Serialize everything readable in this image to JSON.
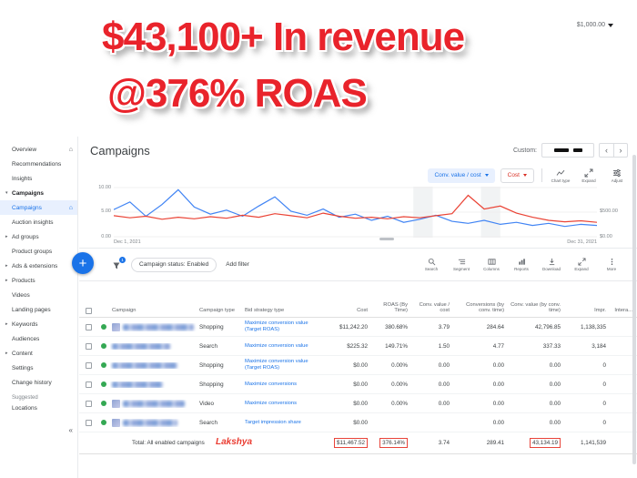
{
  "colors": {
    "accent_blue": "#1a73e8",
    "line_blue": "#4285f4",
    "line_red": "#ea4335",
    "banner_red": "#e9232b",
    "highlight_red": "#e8443a",
    "status_green": "#34a853"
  },
  "banner": {
    "line1": "$43,100+ In revenue",
    "line2": "@376% ROAS",
    "peek_value": "$1,000.00"
  },
  "sidebar": {
    "items": [
      {
        "label": "Overview",
        "icon": "home"
      },
      {
        "label": "Recommendations"
      },
      {
        "label": "Insights"
      },
      {
        "label": "Campaigns",
        "arrow": "down",
        "section": true
      },
      {
        "label": "Campaigns",
        "selected": true,
        "icon": "home"
      },
      {
        "label": "Auction insights"
      },
      {
        "label": "Ad groups",
        "arrow": "right"
      },
      {
        "label": "Product groups"
      },
      {
        "label": "Ads & extensions",
        "arrow": "right"
      },
      {
        "label": "Products",
        "arrow": "right"
      },
      {
        "label": "Videos"
      },
      {
        "label": "Landing pages"
      },
      {
        "label": "Keywords",
        "arrow": "right"
      },
      {
        "label": "Audiences"
      },
      {
        "label": "Content",
        "arrow": "right"
      },
      {
        "label": "Settings"
      },
      {
        "label": "Change history"
      }
    ],
    "suggested_label": "Suggested",
    "suggested_items": [
      {
        "label": "Locations"
      }
    ],
    "collapse_icon": "«"
  },
  "header": {
    "title": "Campaigns",
    "date_range_label": "Custom:"
  },
  "chart_controls": {
    "metric1": {
      "label": "Conv. value / cost"
    },
    "metric2": {
      "label": "Cost"
    },
    "tools": [
      {
        "label": "Chart type",
        "icon": "chart-type"
      },
      {
        "label": "Expand",
        "icon": "expand"
      },
      {
        "label": "Adjust",
        "icon": "adjust"
      }
    ]
  },
  "chart_data": {
    "type": "line",
    "x_start_label": "Dec 1, 2021",
    "x_end_label": "Dec 31, 2021",
    "left_axis_ticks": [
      "10.00",
      "5.00",
      "0.00"
    ],
    "right_axis_ticks": [
      "$500.00",
      "$0.00"
    ],
    "left_range": [
      0,
      10
    ],
    "right_range": [
      0,
      1000
    ],
    "highlight_bands": [
      {
        "from": 0.62,
        "to": 0.66
      },
      {
        "from": 0.76,
        "to": 0.8
      }
    ],
    "series": [
      {
        "name": "Conv. value / cost",
        "axis": "left",
        "color": "#4285f4",
        "values": [
          5.5,
          7.0,
          4.2,
          6.5,
          9.4,
          6.0,
          4.6,
          5.4,
          4.2,
          6.2,
          8.0,
          5.2,
          4.4,
          5.6,
          4.0,
          4.6,
          3.4,
          4.2,
          3.0,
          3.6,
          4.4,
          3.2,
          2.8,
          3.4,
          2.6,
          3.0,
          2.4,
          2.8,
          2.2,
          2.6,
          2.4
        ]
      },
      {
        "name": "Cost",
        "axis": "right",
        "color": "#ea4335",
        "values": [
          430,
          390,
          420,
          360,
          400,
          370,
          410,
          380,
          440,
          400,
          470,
          430,
          390,
          480,
          420,
          380,
          400,
          370,
          410,
          390,
          430,
          470,
          830,
          560,
          620,
          480,
          400,
          340,
          310,
          330,
          300
        ]
      }
    ]
  },
  "filter_bar": {
    "filter_count": "1",
    "status_chip": "Campaign status: Enabled",
    "add_filter_label": "Add filter",
    "tools": [
      {
        "label": "Search",
        "icon": "search"
      },
      {
        "label": "Segment",
        "icon": "segment"
      },
      {
        "label": "Columns",
        "icon": "columns"
      },
      {
        "label": "Reports",
        "icon": "reports"
      },
      {
        "label": "Download",
        "icon": "download"
      },
      {
        "label": "Expand",
        "icon": "expand"
      },
      {
        "label": "More",
        "icon": "more"
      }
    ]
  },
  "table": {
    "columns": [
      {
        "key": "campaign",
        "label": "Campaign",
        "align": "left"
      },
      {
        "key": "type",
        "label": "Campaign type",
        "align": "left"
      },
      {
        "key": "bid",
        "label": "Bid strategy type",
        "align": "left"
      },
      {
        "key": "cost",
        "label": "Cost",
        "align": "right"
      },
      {
        "key": "roas",
        "label": "ROAS (By Time)",
        "align": "right"
      },
      {
        "key": "cvc",
        "label": "Conv. value / cost",
        "align": "right"
      },
      {
        "key": "conversions",
        "label": "Conversions (by conv. time)",
        "align": "right"
      },
      {
        "key": "convvalue",
        "label": "Conv. value (by conv. time)",
        "align": "right"
      },
      {
        "key": "impr",
        "label": "Impr.",
        "align": "right"
      },
      {
        "key": "interactions",
        "label": "Intera...",
        "align": "right"
      }
    ],
    "rows": [
      {
        "status": "enabled",
        "thumb": true,
        "redacted": true,
        "type": "Shopping",
        "bid": "Maximize conversion value (Target ROAS)",
        "cost": "$11,242.20",
        "roas": "380.68%",
        "cvc": "3.79",
        "conversions": "284.64",
        "convvalue": "42,796.85",
        "impr": "1,138,335",
        "interactions": ""
      },
      {
        "status": "enabled",
        "thumb": false,
        "redacted": true,
        "type": "Search",
        "bid": "Maximize conversion value",
        "cost": "$225.32",
        "roas": "149.71%",
        "cvc": "1.50",
        "conversions": "4.77",
        "convvalue": "337.33",
        "impr": "3,184",
        "interactions": ""
      },
      {
        "status": "enabled",
        "thumb": false,
        "redacted": true,
        "type": "Shopping",
        "bid": "Maximize conversion value (Target ROAS)",
        "cost": "$0.00",
        "roas": "0.00%",
        "cvc": "0.00",
        "conversions": "0.00",
        "convvalue": "0.00",
        "impr": "0",
        "interactions": ""
      },
      {
        "status": "enabled",
        "thumb": false,
        "redacted": true,
        "type": "Shopping",
        "bid": "Maximize conversions",
        "cost": "$0.00",
        "roas": "0.00%",
        "cvc": "0.00",
        "conversions": "0.00",
        "convvalue": "0.00",
        "impr": "0",
        "interactions": ""
      },
      {
        "status": "enabled",
        "thumb": true,
        "redacted": true,
        "type": "Video",
        "bid": "Maximize conversions",
        "cost": "$0.00",
        "roas": "0.00%",
        "cvc": "0.00",
        "conversions": "0.00",
        "convvalue": "0.00",
        "impr": "0",
        "interactions": ""
      },
      {
        "status": "enabled",
        "thumb": true,
        "redacted": true,
        "type": "Search",
        "bid": "Target impression share",
        "cost": "$0.00",
        "roas": "",
        "cvc": "",
        "conversions": "0.00",
        "convvalue": "0.00",
        "impr": "0",
        "interactions": ""
      }
    ],
    "total_row": {
      "label": "Total: All enabled campaigns",
      "cost": "$11,467.52",
      "roas": "376.14%",
      "cvc": "3.74",
      "conversions": "289.41",
      "convvalue": "43,134.19",
      "impr": "1,141,539",
      "interactions": "",
      "highlighted": [
        "cost",
        "roas",
        "convvalue"
      ]
    },
    "annotation": "Lakshya"
  }
}
